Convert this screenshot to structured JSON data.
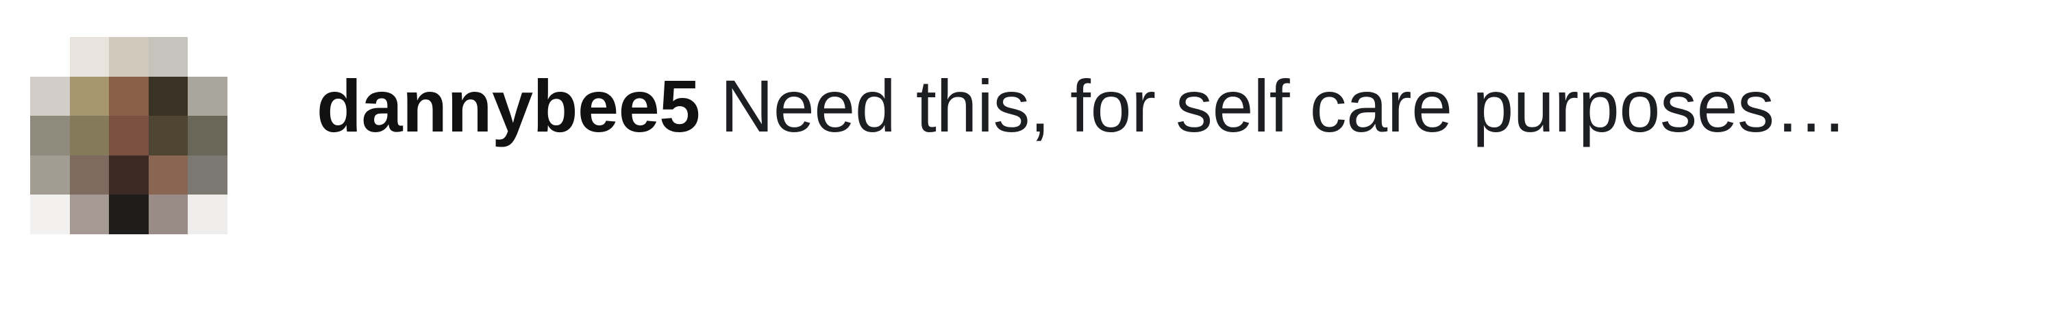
{
  "comment": {
    "username": "dannybee5",
    "text": "Need this, for self care purposes…"
  },
  "avatar": {
    "pixel_colors": [
      [
        "#ffffff",
        "#e8e4dd",
        "#cfc8bb",
        "#c6c3bd",
        "#ffffff"
      ],
      [
        "#d2cec7",
        "#a8966f",
        "#8a5f47",
        "#3b3226",
        "#a9a69d"
      ],
      [
        "#8f8b7c",
        "#857a59",
        "#7a5142",
        "#4e4532",
        "#6a6658"
      ],
      [
        "#a19d93",
        "#7e6a5e",
        "#3b2b24",
        "#8a6551",
        "#7c7973"
      ],
      [
        "#f3f1ef",
        "#a49a93",
        "#1f1d1c",
        "#998b86",
        "#efedec"
      ]
    ]
  }
}
